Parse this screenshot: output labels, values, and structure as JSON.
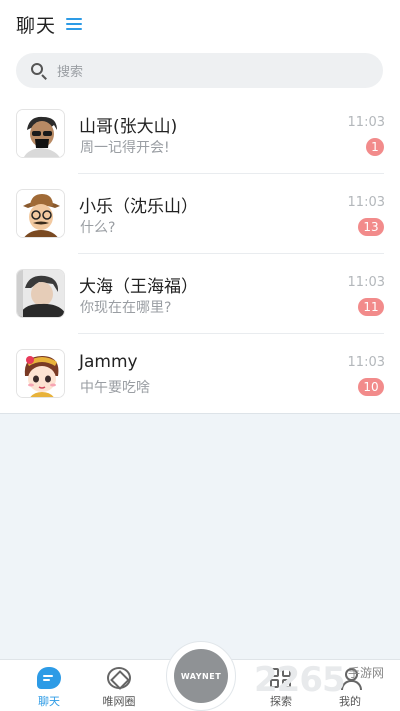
{
  "header": {
    "title": "聊天",
    "menu_icon": "menu-icon"
  },
  "search": {
    "placeholder": "搜索"
  },
  "chats": [
    {
      "name": "山哥(张大山)",
      "message": "周一记得开会!",
      "time": "11:03",
      "unread": "1"
    },
    {
      "name": "小乐（沈乐山）",
      "message": "什么?",
      "time": "11:03",
      "unread": "13"
    },
    {
      "name": "大海（王海福）",
      "message": "你现在在哪里?",
      "time": "11:03",
      "unread": "11"
    },
    {
      "name": "Jammy",
      "message": "中午要吃啥",
      "time": "11:03",
      "unread": "10"
    }
  ],
  "tabbar": {
    "tabs": [
      {
        "label": "聊天",
        "icon": "chat-icon",
        "active": true
      },
      {
        "label": "唯网圈",
        "icon": "circle-icon"
      },
      {
        "label": "探索",
        "icon": "grid-icon"
      },
      {
        "label": "我的",
        "icon": "user-icon"
      }
    ],
    "center_button": "WAYNET"
  },
  "watermark": {
    "number": "2265",
    "text": "手游网"
  },
  "colors": {
    "accent": "#2d9be6",
    "badge": "#f28b8b",
    "background": "#eff4f8"
  }
}
